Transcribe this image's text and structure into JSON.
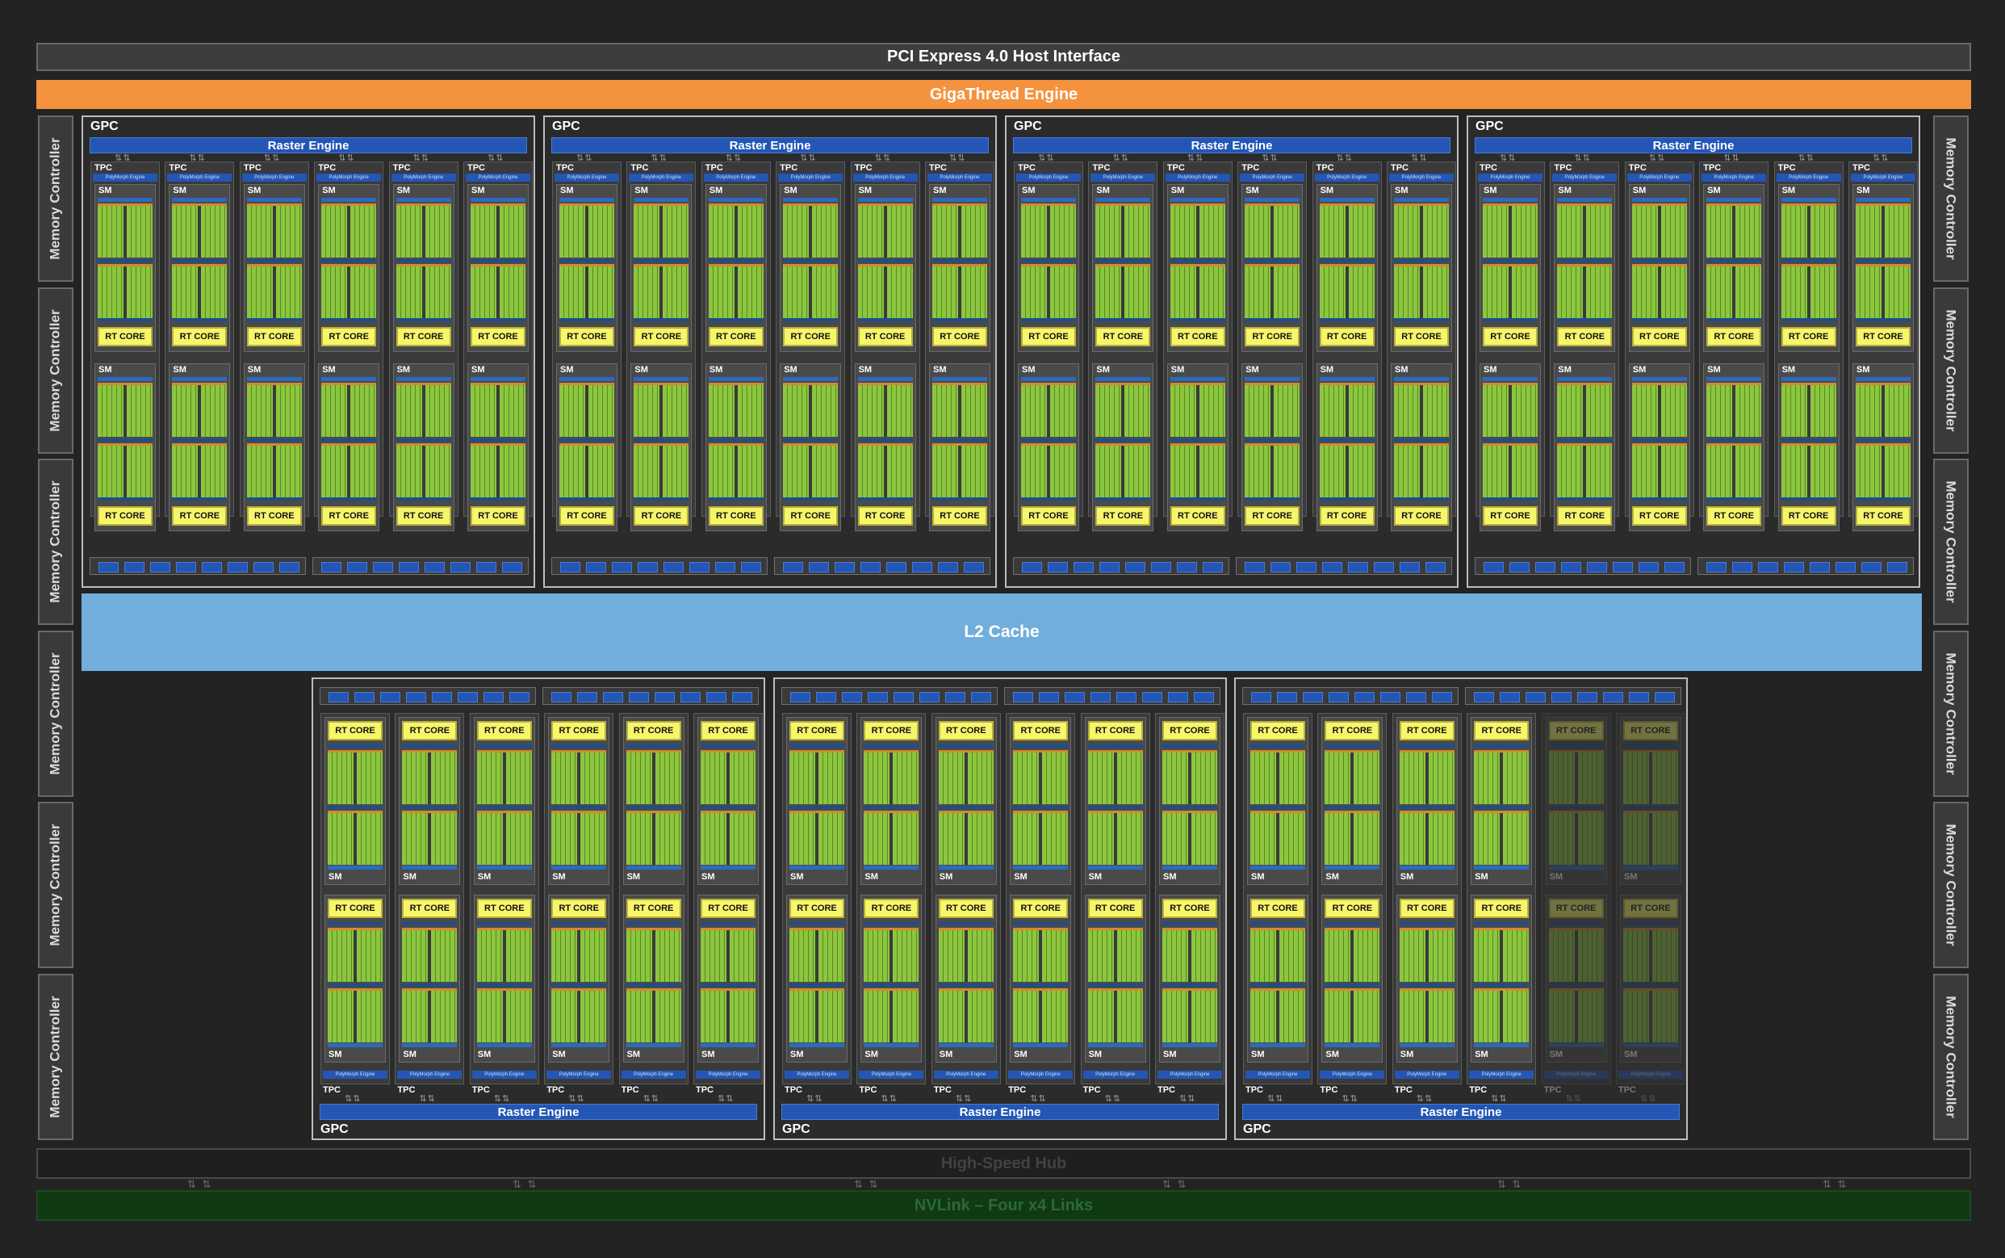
{
  "bars": {
    "pcie": "PCI Express 4.0 Host Interface",
    "gigathread": "GigaThread Engine",
    "l2": "L2 Cache",
    "hub": "High-Speed Hub",
    "nvlink": "NVLink – Four x4 Links"
  },
  "memory_controller": "Memory Controller",
  "gpc": {
    "label": "GPC",
    "raster": "Raster Engine",
    "tpc": "TPC",
    "polymorph": "PolyMorph Engine",
    "sm": "SM",
    "rt_core": "RT CORE"
  },
  "layout_counts": {
    "gpc_count": 7,
    "tpcs_per_gpc": 6,
    "sms_per_tpc": 2,
    "memory_controllers_per_side": 6,
    "disabled_tpcs_in_last_gpc": 2
  },
  "colors": {
    "cuda_cores": "#8cc63f",
    "rt_core": "#f7f56a",
    "raster": "#2356b5",
    "l2": "#72aedb",
    "gigathread": "#f5923e",
    "nvlink": "#0f3a14"
  }
}
